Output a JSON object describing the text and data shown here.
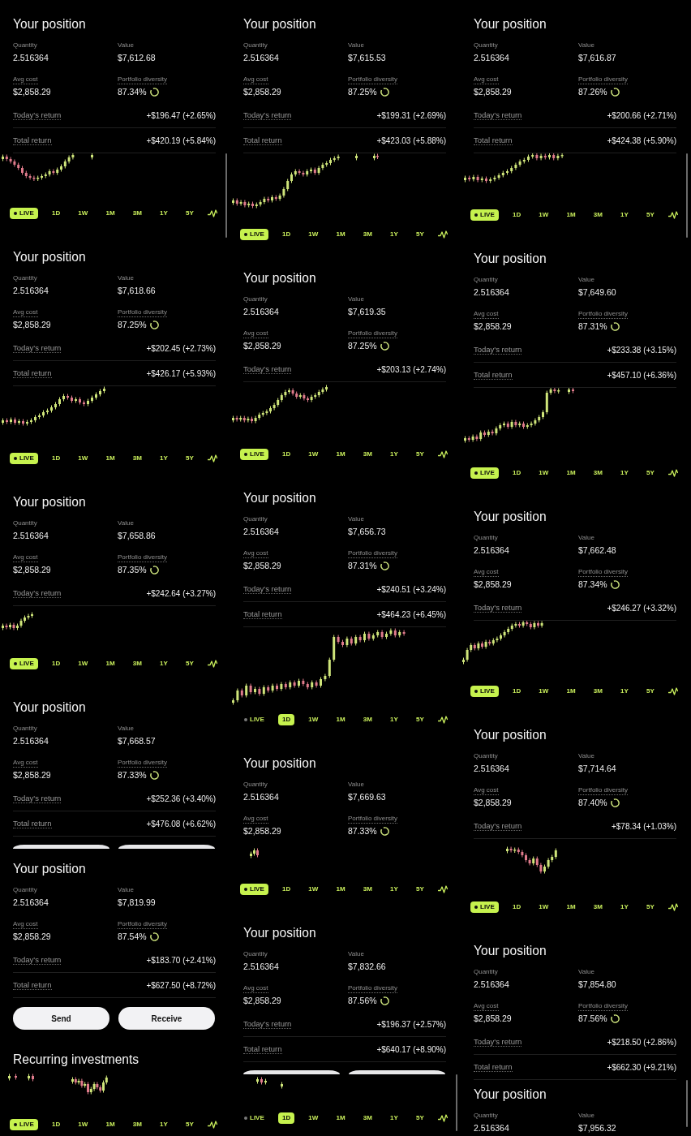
{
  "columns": [
    {
      "blocks": [
        {
          "kind": "position",
          "title": "Your position",
          "stats": [
            {
              "label": "Quantity",
              "value": "2.516364",
              "kind": "plain"
            },
            {
              "label": "Value",
              "value": "$7,612.68",
              "kind": "plain"
            },
            {
              "label": "Avg cost",
              "value": "$2,858.29",
              "kind": "dotted"
            },
            {
              "label": "Portfolio diversity",
              "value": "87.34%",
              "kind": "ring"
            }
          ],
          "returns": [
            {
              "label": "Today's return",
              "value": "+$196.47 (+2.65%)"
            },
            {
              "label": "Total return",
              "value": "+$420.19 (+5.84%)"
            }
          ]
        },
        {
          "kind": "scrollbar"
        },
        {
          "kind": "chart"
        },
        {
          "kind": "ranges",
          "items": [
            {
              "label": "LIVE",
              "kind": "live",
              "selected": true
            },
            {
              "label": "1D",
              "kind": "period",
              "selected": false
            },
            {
              "label": "1W",
              "kind": "period",
              "selected": false
            },
            {
              "label": "1M",
              "kind": "period",
              "selected": false
            },
            {
              "label": "3M",
              "kind": "period",
              "selected": false
            },
            {
              "label": "1Y",
              "kind": "period",
              "selected": false
            },
            {
              "label": "5Y",
              "kind": "period",
              "selected": false
            }
          ]
        },
        {
          "kind": "position",
          "title": "Your position",
          "stats": [
            {
              "label": "Quantity",
              "value": "2.516364",
              "kind": "plain"
            },
            {
              "label": "Value",
              "value": "$7,618.66",
              "kind": "plain"
            },
            {
              "label": "Avg cost",
              "value": "$2,858.29",
              "kind": "dotted"
            },
            {
              "label": "Portfolio diversity",
              "value": "87.25%",
              "kind": "ring"
            }
          ],
          "returns": [
            {
              "label": "Today's return",
              "value": "+$202.45 (+2.73%)"
            },
            {
              "label": "Total return",
              "value": "+$426.17 (+5.93%)"
            }
          ]
        },
        {
          "kind": "chart"
        },
        {
          "kind": "ranges",
          "items": [
            {
              "label": "LIVE",
              "kind": "live",
              "selected": true
            },
            {
              "label": "1D",
              "kind": "period",
              "selected": false
            },
            {
              "label": "1W",
              "kind": "period",
              "selected": false
            },
            {
              "label": "1M",
              "kind": "period",
              "selected": false
            },
            {
              "label": "3M",
              "kind": "period",
              "selected": false
            },
            {
              "label": "1Y",
              "kind": "period",
              "selected": false
            },
            {
              "label": "5Y",
              "kind": "period",
              "selected": false
            }
          ]
        },
        {
          "kind": "position",
          "title": "Your position",
          "stats": [
            {
              "label": "Quantity",
              "value": "2.516364",
              "kind": "plain"
            },
            {
              "label": "Value",
              "value": "$7,658.86",
              "kind": "plain"
            },
            {
              "label": "Avg cost",
              "value": "$2,858.29",
              "kind": "dotted"
            },
            {
              "label": "Portfolio diversity",
              "value": "87.35%",
              "kind": "ring"
            }
          ],
          "returns": [
            {
              "label": "Today's return",
              "value": "+$242.64 (+3.27%)"
            }
          ]
        },
        {
          "kind": "chart"
        },
        {
          "kind": "ranges",
          "items": [
            {
              "label": "LIVE",
              "kind": "live",
              "selected": true
            },
            {
              "label": "1D",
              "kind": "period",
              "selected": false
            },
            {
              "label": "1W",
              "kind": "period",
              "selected": false
            },
            {
              "label": "1M",
              "kind": "period",
              "selected": false
            },
            {
              "label": "3M",
              "kind": "period",
              "selected": false
            },
            {
              "label": "1Y",
              "kind": "period",
              "selected": false
            },
            {
              "label": "5Y",
              "kind": "period",
              "selected": false
            }
          ]
        },
        {
          "kind": "position",
          "title": "Your position",
          "stats": [
            {
              "label": "Quantity",
              "value": "2.516364",
              "kind": "plain"
            },
            {
              "label": "Value",
              "value": "$7,668.57",
              "kind": "plain"
            },
            {
              "label": "Avg cost",
              "value": "$2,858.29",
              "kind": "dotted"
            },
            {
              "label": "Portfolio diversity",
              "value": "87.33%",
              "kind": "ring"
            }
          ],
          "returns": [
            {
              "label": "Today's return",
              "value": "+$252.36 (+3.40%)"
            },
            {
              "label": "Total return",
              "value": "+$476.08 (+6.62%)"
            }
          ]
        },
        {
          "kind": "buttons",
          "items": [
            {
              "cut": true
            },
            {
              "cut": true
            }
          ]
        },
        {
          "kind": "position",
          "title": "Your position",
          "stats": [
            {
              "label": "Quantity",
              "value": "2.516364",
              "kind": "plain"
            },
            {
              "label": "Value",
              "value": "$7,819.99",
              "kind": "plain"
            },
            {
              "label": "Avg cost",
              "value": "$2,858.29",
              "kind": "dotted"
            },
            {
              "label": "Portfolio diversity",
              "value": "87.54%",
              "kind": "ring"
            }
          ],
          "returns": [
            {
              "label": "Today's return",
              "value": "+$183.70 (+2.41%)"
            },
            {
              "label": "Total return",
              "value": "+$627.50 (+8.72%)"
            }
          ]
        },
        {
          "kind": "buttons",
          "items": [
            {
              "label": "Send",
              "cut": false
            },
            {
              "label": "Receive",
              "cut": false
            }
          ]
        },
        {
          "kind": "heading",
          "text": "Recurring investments"
        },
        {
          "kind": "chart"
        },
        {
          "kind": "ranges",
          "items": [
            {
              "label": "LIVE",
              "kind": "live",
              "selected": true
            },
            {
              "label": "1D",
              "kind": "period",
              "selected": false
            },
            {
              "label": "1W",
              "kind": "period",
              "selected": false
            },
            {
              "label": "1M",
              "kind": "period",
              "selected": false
            },
            {
              "label": "3M",
              "kind": "period",
              "selected": false
            },
            {
              "label": "1Y",
              "kind": "period",
              "selected": false
            },
            {
              "label": "5Y",
              "kind": "period",
              "selected": false
            }
          ]
        }
      ]
    },
    {
      "blocks": [
        {
          "kind": "position",
          "title": "Your position",
          "stats": [
            {
              "label": "Quantity",
              "value": "2.516364",
              "kind": "plain"
            },
            {
              "label": "Value",
              "value": "$7,615.53",
              "kind": "plain"
            },
            {
              "label": "Avg cost",
              "value": "$2,858.29",
              "kind": "dotted"
            },
            {
              "label": "Portfolio diversity",
              "value": "87.25%",
              "kind": "ring"
            }
          ],
          "returns": [
            {
              "label": "Today's return",
              "value": "+$199.31 (+2.69%)"
            },
            {
              "label": "Total return",
              "value": "+$423.03 (+5.88%)"
            }
          ]
        },
        {
          "kind": "chart"
        },
        {
          "kind": "ranges",
          "items": [
            {
              "label": "LIVE",
              "kind": "live",
              "selected": true
            },
            {
              "label": "1D",
              "kind": "period",
              "selected": false
            },
            {
              "label": "1W",
              "kind": "period",
              "selected": false
            },
            {
              "label": "1M",
              "kind": "period",
              "selected": false
            },
            {
              "label": "3M",
              "kind": "period",
              "selected": false
            },
            {
              "label": "1Y",
              "kind": "period",
              "selected": false
            },
            {
              "label": "5Y",
              "kind": "period",
              "selected": false
            }
          ]
        },
        {
          "kind": "position",
          "title": "Your position",
          "stats": [
            {
              "label": "Quantity",
              "value": "2.516364",
              "kind": "plain"
            },
            {
              "label": "Value",
              "value": "$7,619.35",
              "kind": "plain"
            },
            {
              "label": "Avg cost",
              "value": "$2,858.29",
              "kind": "dotted"
            },
            {
              "label": "Portfolio diversity",
              "value": "87.25%",
              "kind": "ring"
            }
          ],
          "returns": [
            {
              "label": "Today's return",
              "value": "+$203.13 (+2.74%)"
            }
          ]
        },
        {
          "kind": "chart"
        },
        {
          "kind": "ranges",
          "items": [
            {
              "label": "LIVE",
              "kind": "live",
              "selected": true
            },
            {
              "label": "1D",
              "kind": "period",
              "selected": false
            },
            {
              "label": "1W",
              "kind": "period",
              "selected": false
            },
            {
              "label": "1M",
              "kind": "period",
              "selected": false
            },
            {
              "label": "3M",
              "kind": "period",
              "selected": false
            },
            {
              "label": "1Y",
              "kind": "period",
              "selected": false
            },
            {
              "label": "5Y",
              "kind": "period",
              "selected": false
            }
          ]
        },
        {
          "kind": "position",
          "title": "Your position",
          "stats": [
            {
              "label": "Quantity",
              "value": "2.516364",
              "kind": "plain"
            },
            {
              "label": "Value",
              "value": "$7,656.73",
              "kind": "plain"
            },
            {
              "label": "Avg cost",
              "value": "$2,858.29",
              "kind": "dotted"
            },
            {
              "label": "Portfolio diversity",
              "value": "87.31%",
              "kind": "ring"
            }
          ],
          "returns": [
            {
              "label": "Today's return",
              "value": "+$240.51 (+3.24%)"
            },
            {
              "label": "Total return",
              "value": "+$464.23 (+6.45%)"
            }
          ]
        },
        {
          "kind": "chart"
        },
        {
          "kind": "ranges",
          "items": [
            {
              "label": "LIVE",
              "kind": "live",
              "selected": false
            },
            {
              "label": "1D",
              "kind": "period",
              "selected": true
            },
            {
              "label": "1W",
              "kind": "period",
              "selected": false
            },
            {
              "label": "1M",
              "kind": "period",
              "selected": false
            },
            {
              "label": "3M",
              "kind": "period",
              "selected": false
            },
            {
              "label": "1Y",
              "kind": "period",
              "selected": false
            },
            {
              "label": "5Y",
              "kind": "period",
              "selected": false
            }
          ]
        },
        {
          "kind": "position",
          "title": "Your position",
          "stats": [
            {
              "label": "Quantity",
              "value": "2.516364",
              "kind": "plain"
            },
            {
              "label": "Value",
              "value": "$7,669.63",
              "kind": "plain"
            },
            {
              "label": "Avg cost",
              "value": "$2,858.29",
              "kind": "dotted"
            },
            {
              "label": "Portfolio diversity",
              "value": "87.33%",
              "kind": "ring"
            }
          ]
        },
        {
          "kind": "chart"
        },
        {
          "kind": "ranges",
          "items": [
            {
              "label": "LIVE",
              "kind": "live",
              "selected": true
            },
            {
              "label": "1D",
              "kind": "period",
              "selected": false
            },
            {
              "label": "1W",
              "kind": "period",
              "selected": false
            },
            {
              "label": "1M",
              "kind": "period",
              "selected": false
            },
            {
              "label": "3M",
              "kind": "period",
              "selected": false
            },
            {
              "label": "1Y",
              "kind": "period",
              "selected": false
            },
            {
              "label": "5Y",
              "kind": "period",
              "selected": false
            }
          ]
        },
        {
          "kind": "position",
          "title": "Your position",
          "stats": [
            {
              "label": "Quantity",
              "value": "2.516364",
              "kind": "plain"
            },
            {
              "label": "Value",
              "value": "$7,832.66",
              "kind": "plain"
            },
            {
              "label": "Avg cost",
              "value": "$2,858.29",
              "kind": "dotted"
            },
            {
              "label": "Portfolio diversity",
              "value": "87.56%",
              "kind": "ring"
            }
          ],
          "returns": [
            {
              "label": "Today's return",
              "value": "+$196.37 (+2.57%)"
            },
            {
              "label": "Total return",
              "value": "+$640.17 (+8.90%)"
            }
          ]
        },
        {
          "kind": "buttons",
          "items": [
            {
              "cut": true
            },
            {
              "cut": true
            }
          ]
        },
        {
          "kind": "scrollbar"
        },
        {
          "kind": "chart"
        },
        {
          "kind": "ranges",
          "items": [
            {
              "label": "LIVE",
              "kind": "live",
              "selected": false
            },
            {
              "label": "1D",
              "kind": "period",
              "selected": true
            },
            {
              "label": "1W",
              "kind": "period",
              "selected": false
            },
            {
              "label": "1M",
              "kind": "period",
              "selected": false
            },
            {
              "label": "3M",
              "kind": "period",
              "selected": false
            },
            {
              "label": "1Y",
              "kind": "period",
              "selected": false
            },
            {
              "label": "5Y",
              "kind": "period",
              "selected": false
            }
          ]
        }
      ]
    },
    {
      "blocks": [
        {
          "kind": "position",
          "title": "Your position",
          "stats": [
            {
              "label": "Quantity",
              "value": "2.516364",
              "kind": "plain"
            },
            {
              "label": "Value",
              "value": "$7,616.87",
              "kind": "plain"
            },
            {
              "label": "Avg cost",
              "value": "$2,858.29",
              "kind": "dotted"
            },
            {
              "label": "Portfolio diversity",
              "value": "87.26%",
              "kind": "ring"
            }
          ],
          "returns": [
            {
              "label": "Today's return",
              "value": "+$200.66 (+2.71%)"
            },
            {
              "label": "Total return",
              "value": "+$424.38 (+5.90%)"
            }
          ]
        },
        {
          "kind": "scrollbar"
        },
        {
          "kind": "chart"
        },
        {
          "kind": "ranges",
          "items": [
            {
              "label": "LIVE",
              "kind": "live",
              "selected": true
            },
            {
              "label": "1D",
              "kind": "period",
              "selected": false
            },
            {
              "label": "1W",
              "kind": "period",
              "selected": false
            },
            {
              "label": "1M",
              "kind": "period",
              "selected": false
            },
            {
              "label": "3M",
              "kind": "period",
              "selected": false
            },
            {
              "label": "1Y",
              "kind": "period",
              "selected": false
            },
            {
              "label": "5Y",
              "kind": "period",
              "selected": false
            }
          ]
        },
        {
          "kind": "position",
          "title": "Your position",
          "stats": [
            {
              "label": "Quantity",
              "value": "2.516364",
              "kind": "plain"
            },
            {
              "label": "Value",
              "value": "$7,649.60",
              "kind": "plain"
            },
            {
              "label": "Avg cost",
              "value": "$2,858.29",
              "kind": "dotted"
            },
            {
              "label": "Portfolio diversity",
              "value": "87.31%",
              "kind": "ring"
            }
          ],
          "returns": [
            {
              "label": "Today's return",
              "value": "+$233.38 (+3.15%)"
            },
            {
              "label": "Total return",
              "value": "+$457.10 (+6.36%)"
            }
          ]
        },
        {
          "kind": "chart"
        },
        {
          "kind": "ranges",
          "items": [
            {
              "label": "LIVE",
              "kind": "live",
              "selected": true
            },
            {
              "label": "1D",
              "kind": "period",
              "selected": false
            },
            {
              "label": "1W",
              "kind": "period",
              "selected": false
            },
            {
              "label": "1M",
              "kind": "period",
              "selected": false
            },
            {
              "label": "3M",
              "kind": "period",
              "selected": false
            },
            {
              "label": "1Y",
              "kind": "period",
              "selected": false
            },
            {
              "label": "5Y",
              "kind": "period",
              "selected": false
            }
          ]
        },
        {
          "kind": "position",
          "title": "Your position",
          "stats": [
            {
              "label": "Quantity",
              "value": "2.516364",
              "kind": "plain"
            },
            {
              "label": "Value",
              "value": "$7,662.48",
              "kind": "plain"
            },
            {
              "label": "Avg cost",
              "value": "$2,858.29",
              "kind": "dotted"
            },
            {
              "label": "Portfolio diversity",
              "value": "87.34%",
              "kind": "ring"
            }
          ],
          "returns": [
            {
              "label": "Today's return",
              "value": "+$246.27 (+3.32%)"
            }
          ]
        },
        {
          "kind": "chart"
        },
        {
          "kind": "ranges",
          "items": [
            {
              "label": "LIVE",
              "kind": "live",
              "selected": true
            },
            {
              "label": "1D",
              "kind": "period",
              "selected": false
            },
            {
              "label": "1W",
              "kind": "period",
              "selected": false
            },
            {
              "label": "1M",
              "kind": "period",
              "selected": false
            },
            {
              "label": "3M",
              "kind": "period",
              "selected": false
            },
            {
              "label": "1Y",
              "kind": "period",
              "selected": false
            },
            {
              "label": "5Y",
              "kind": "period",
              "selected": false
            }
          ]
        },
        {
          "kind": "position",
          "title": "Your position",
          "stats": [
            {
              "label": "Quantity",
              "value": "2.516364",
              "kind": "plain"
            },
            {
              "label": "Value",
              "value": "$7,714.64",
              "kind": "plain"
            },
            {
              "label": "Avg cost",
              "value": "$2,858.29",
              "kind": "dotted"
            },
            {
              "label": "Portfolio diversity",
              "value": "87.40%",
              "kind": "ring"
            }
          ],
          "returns": [
            {
              "label": "Today's return",
              "value": "+$78.34 (+1.03%)"
            }
          ]
        },
        {
          "kind": "chart"
        },
        {
          "kind": "ranges",
          "items": [
            {
              "label": "LIVE",
              "kind": "live",
              "selected": true
            },
            {
              "label": "1D",
              "kind": "period",
              "selected": false
            },
            {
              "label": "1W",
              "kind": "period",
              "selected": false
            },
            {
              "label": "1M",
              "kind": "period",
              "selected": false
            },
            {
              "label": "3M",
              "kind": "period",
              "selected": false
            },
            {
              "label": "1Y",
              "kind": "period",
              "selected": false
            },
            {
              "label": "5Y",
              "kind": "period",
              "selected": false
            }
          ]
        },
        {
          "kind": "position",
          "title": "Your position",
          "stats": [
            {
              "label": "Quantity",
              "value": "2.516364",
              "kind": "plain"
            },
            {
              "label": "Value",
              "value": "$7,854.80",
              "kind": "plain"
            },
            {
              "label": "Avg cost",
              "value": "$2,858.29",
              "kind": "dotted"
            },
            {
              "label": "Portfolio diversity",
              "value": "87.56%",
              "kind": "ring"
            }
          ],
          "returns": [
            {
              "label": "Today's return",
              "value": "+$218.50 (+2.86%)"
            },
            {
              "label": "Total return",
              "value": "+$662.30 (+9.21%)"
            }
          ]
        },
        {
          "kind": "scrollbar"
        },
        {
          "kind": "position",
          "title": "Your position",
          "stats": [
            {
              "label": "Quantity",
              "value": "2.516364",
              "kind": "plain"
            },
            {
              "label": "Value",
              "value": "$7,956.32",
              "kind": "plain"
            }
          ]
        }
      ]
    }
  ]
}
